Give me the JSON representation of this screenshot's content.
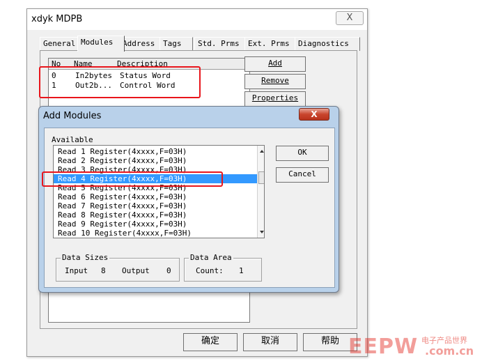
{
  "window": {
    "title": "xdyk MDPB",
    "close_glyph": "X"
  },
  "tabs": [
    {
      "label": "General"
    },
    {
      "label": "Modules"
    },
    {
      "label": "Address"
    },
    {
      "label": "Tags"
    },
    {
      "label": "Std. Prms"
    },
    {
      "label": "Ext. Prms"
    },
    {
      "label": "Diagnostics"
    }
  ],
  "active_tab": "Modules",
  "modules_table": {
    "columns": [
      "No",
      "Name",
      "Description"
    ],
    "rows": [
      {
        "no": "0",
        "name": "In2bytes",
        "desc": "Status Word"
      },
      {
        "no": "1",
        "name": "Out2b...",
        "desc": "Control Word"
      }
    ]
  },
  "side_buttons": {
    "add": "Add",
    "remove": "Remove",
    "properties": "Properties"
  },
  "dialog": {
    "title": "Add Modules",
    "close_glyph": "X",
    "available_label": "Available",
    "items": [
      "Read 1 Register(4xxxx,F=03H)",
      "Read 2 Register(4xxxx,F=03H)",
      "Read 3 Register(4xxxx,F=03H)",
      "Read 4 Register(4xxxx,F=03H)",
      "Read 5 Register(4xxxx,F=03H)",
      "Read 6 Register(4xxxx,F=03H)",
      "Read 7 Register(4xxxx,F=03H)",
      "Read 8 Register(4xxxx,F=03H)",
      "Read 9 Register(4xxxx,F=03H)",
      "Read 10 Register(4xxxx,F=03H)"
    ],
    "selected_index": 3,
    "ok_label": "OK",
    "cancel_label": "Cancel",
    "data_sizes": {
      "label": "Data Sizes",
      "input_label": "Input",
      "input_value": "8",
      "output_label": "Output",
      "output_value": "0"
    },
    "data_area": {
      "label": "Data Area",
      "count_label": "Count:",
      "count_value": "1"
    }
  },
  "bottom_buttons": {
    "ok": "确定",
    "cancel": "取消",
    "help": "帮助"
  },
  "watermark": {
    "logo": "EEPW",
    "chinese": "电子产品世界",
    "domain": ".com.cn"
  },
  "annotation_color": "#e8151b",
  "selection_color": "#3399ff"
}
